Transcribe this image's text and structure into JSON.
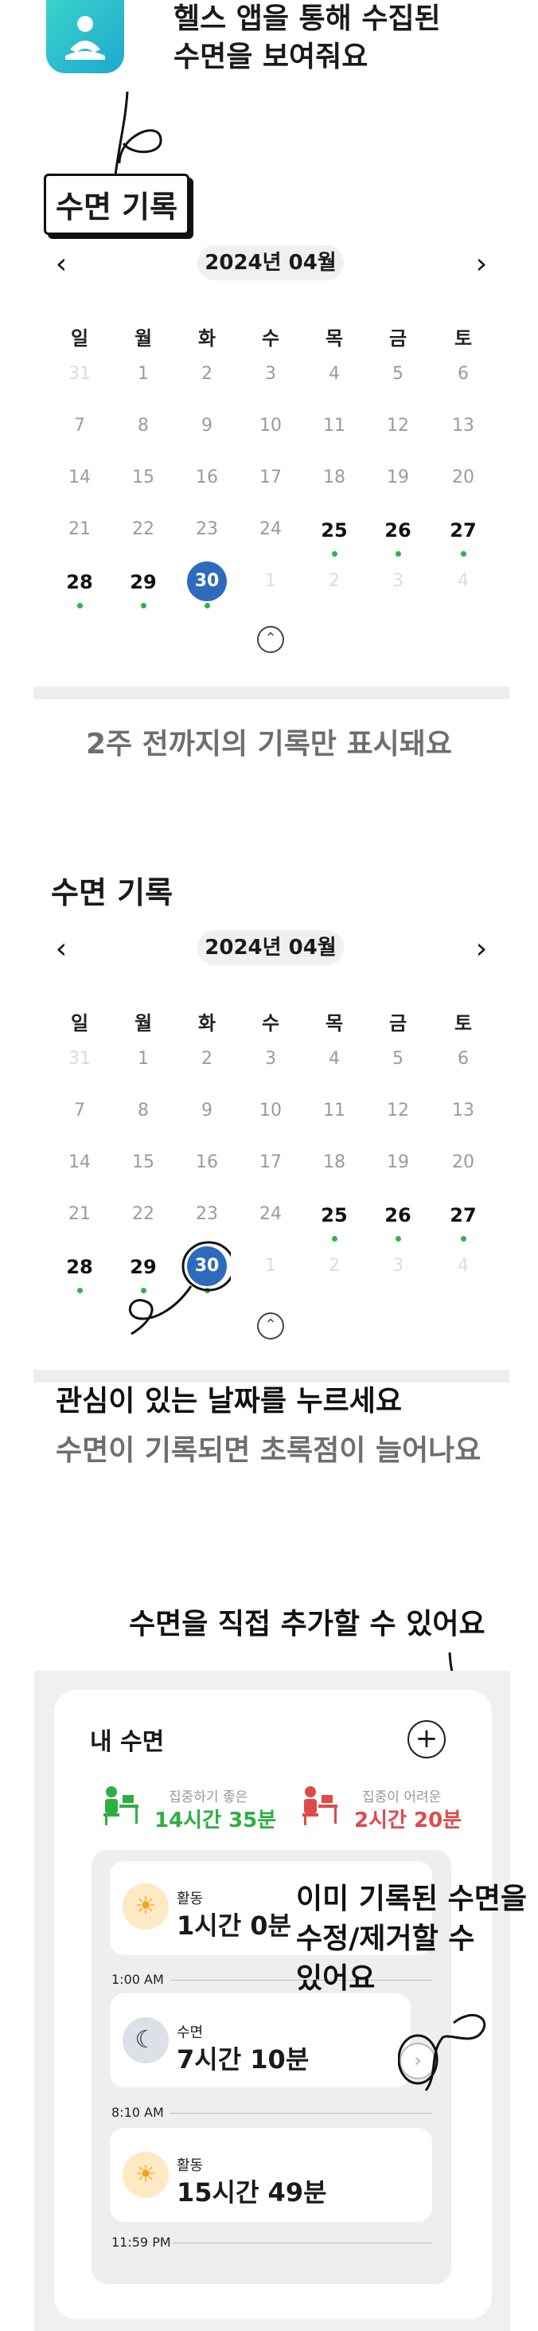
{
  "hero": {
    "title_line1": "헬스 앱을 통해 수집된",
    "title_line2": "수면을 보여줘요"
  },
  "label_sleep_record": "수면 기록",
  "calendar1": {
    "month": "2024년 04월",
    "weekdays": [
      "일",
      "월",
      "화",
      "수",
      "목",
      "금",
      "토"
    ],
    "rows": [
      [
        "31",
        "1",
        "2",
        "3",
        "4",
        "5",
        "6"
      ],
      [
        "7",
        "8",
        "9",
        "10",
        "11",
        "12",
        "13"
      ],
      [
        "14",
        "15",
        "16",
        "17",
        "18",
        "19",
        "20"
      ],
      [
        "21",
        "22",
        "23",
        "24",
        "25",
        "26",
        "27"
      ],
      [
        "28",
        "29",
        "30",
        "1",
        "2",
        "3",
        "4"
      ]
    ],
    "selected": "30",
    "with_record": [
      "25",
      "26",
      "27",
      "28",
      "29",
      "30"
    ]
  },
  "notice_two_weeks": "2주 전까지의 기록만 표시돼요",
  "section2_title": "수면 기록",
  "calendar2": {
    "month": "2024년 04월"
  },
  "tip_line1": "관심이 있는 날짜를 누르세요",
  "tip_line2": "수면이 기록되면 초록점이 늘어나요",
  "add_note": "수면을 직접 추가할 수 있어요",
  "card": {
    "title": "내 수면",
    "plus": "+",
    "good_caption": "집중하기 좋은",
    "good_value": "14시간 35분",
    "bad_caption": "집중이 어려운",
    "bad_value": "2시간 20분",
    "entries": [
      {
        "label": "활동",
        "value": "1시간 0분",
        "icon": "sun-icon"
      },
      {
        "label": "수면",
        "value": "7시간 10분",
        "icon": "moon-icon"
      },
      {
        "label": "활동",
        "value": "15시간 49분",
        "icon": "sun-icon"
      }
    ],
    "times": [
      "1:00 AM",
      "8:10 AM",
      "11:59 PM"
    ]
  },
  "edit_note_line1": "이미 기록된 수면을",
  "edit_note_line2": "수정/제거할 수",
  "edit_note_line3": "있어요",
  "colors": {
    "selected": "#2f6bbd",
    "dot": "#31b24a",
    "good": "#2fae43",
    "bad": "#e04a4a"
  }
}
